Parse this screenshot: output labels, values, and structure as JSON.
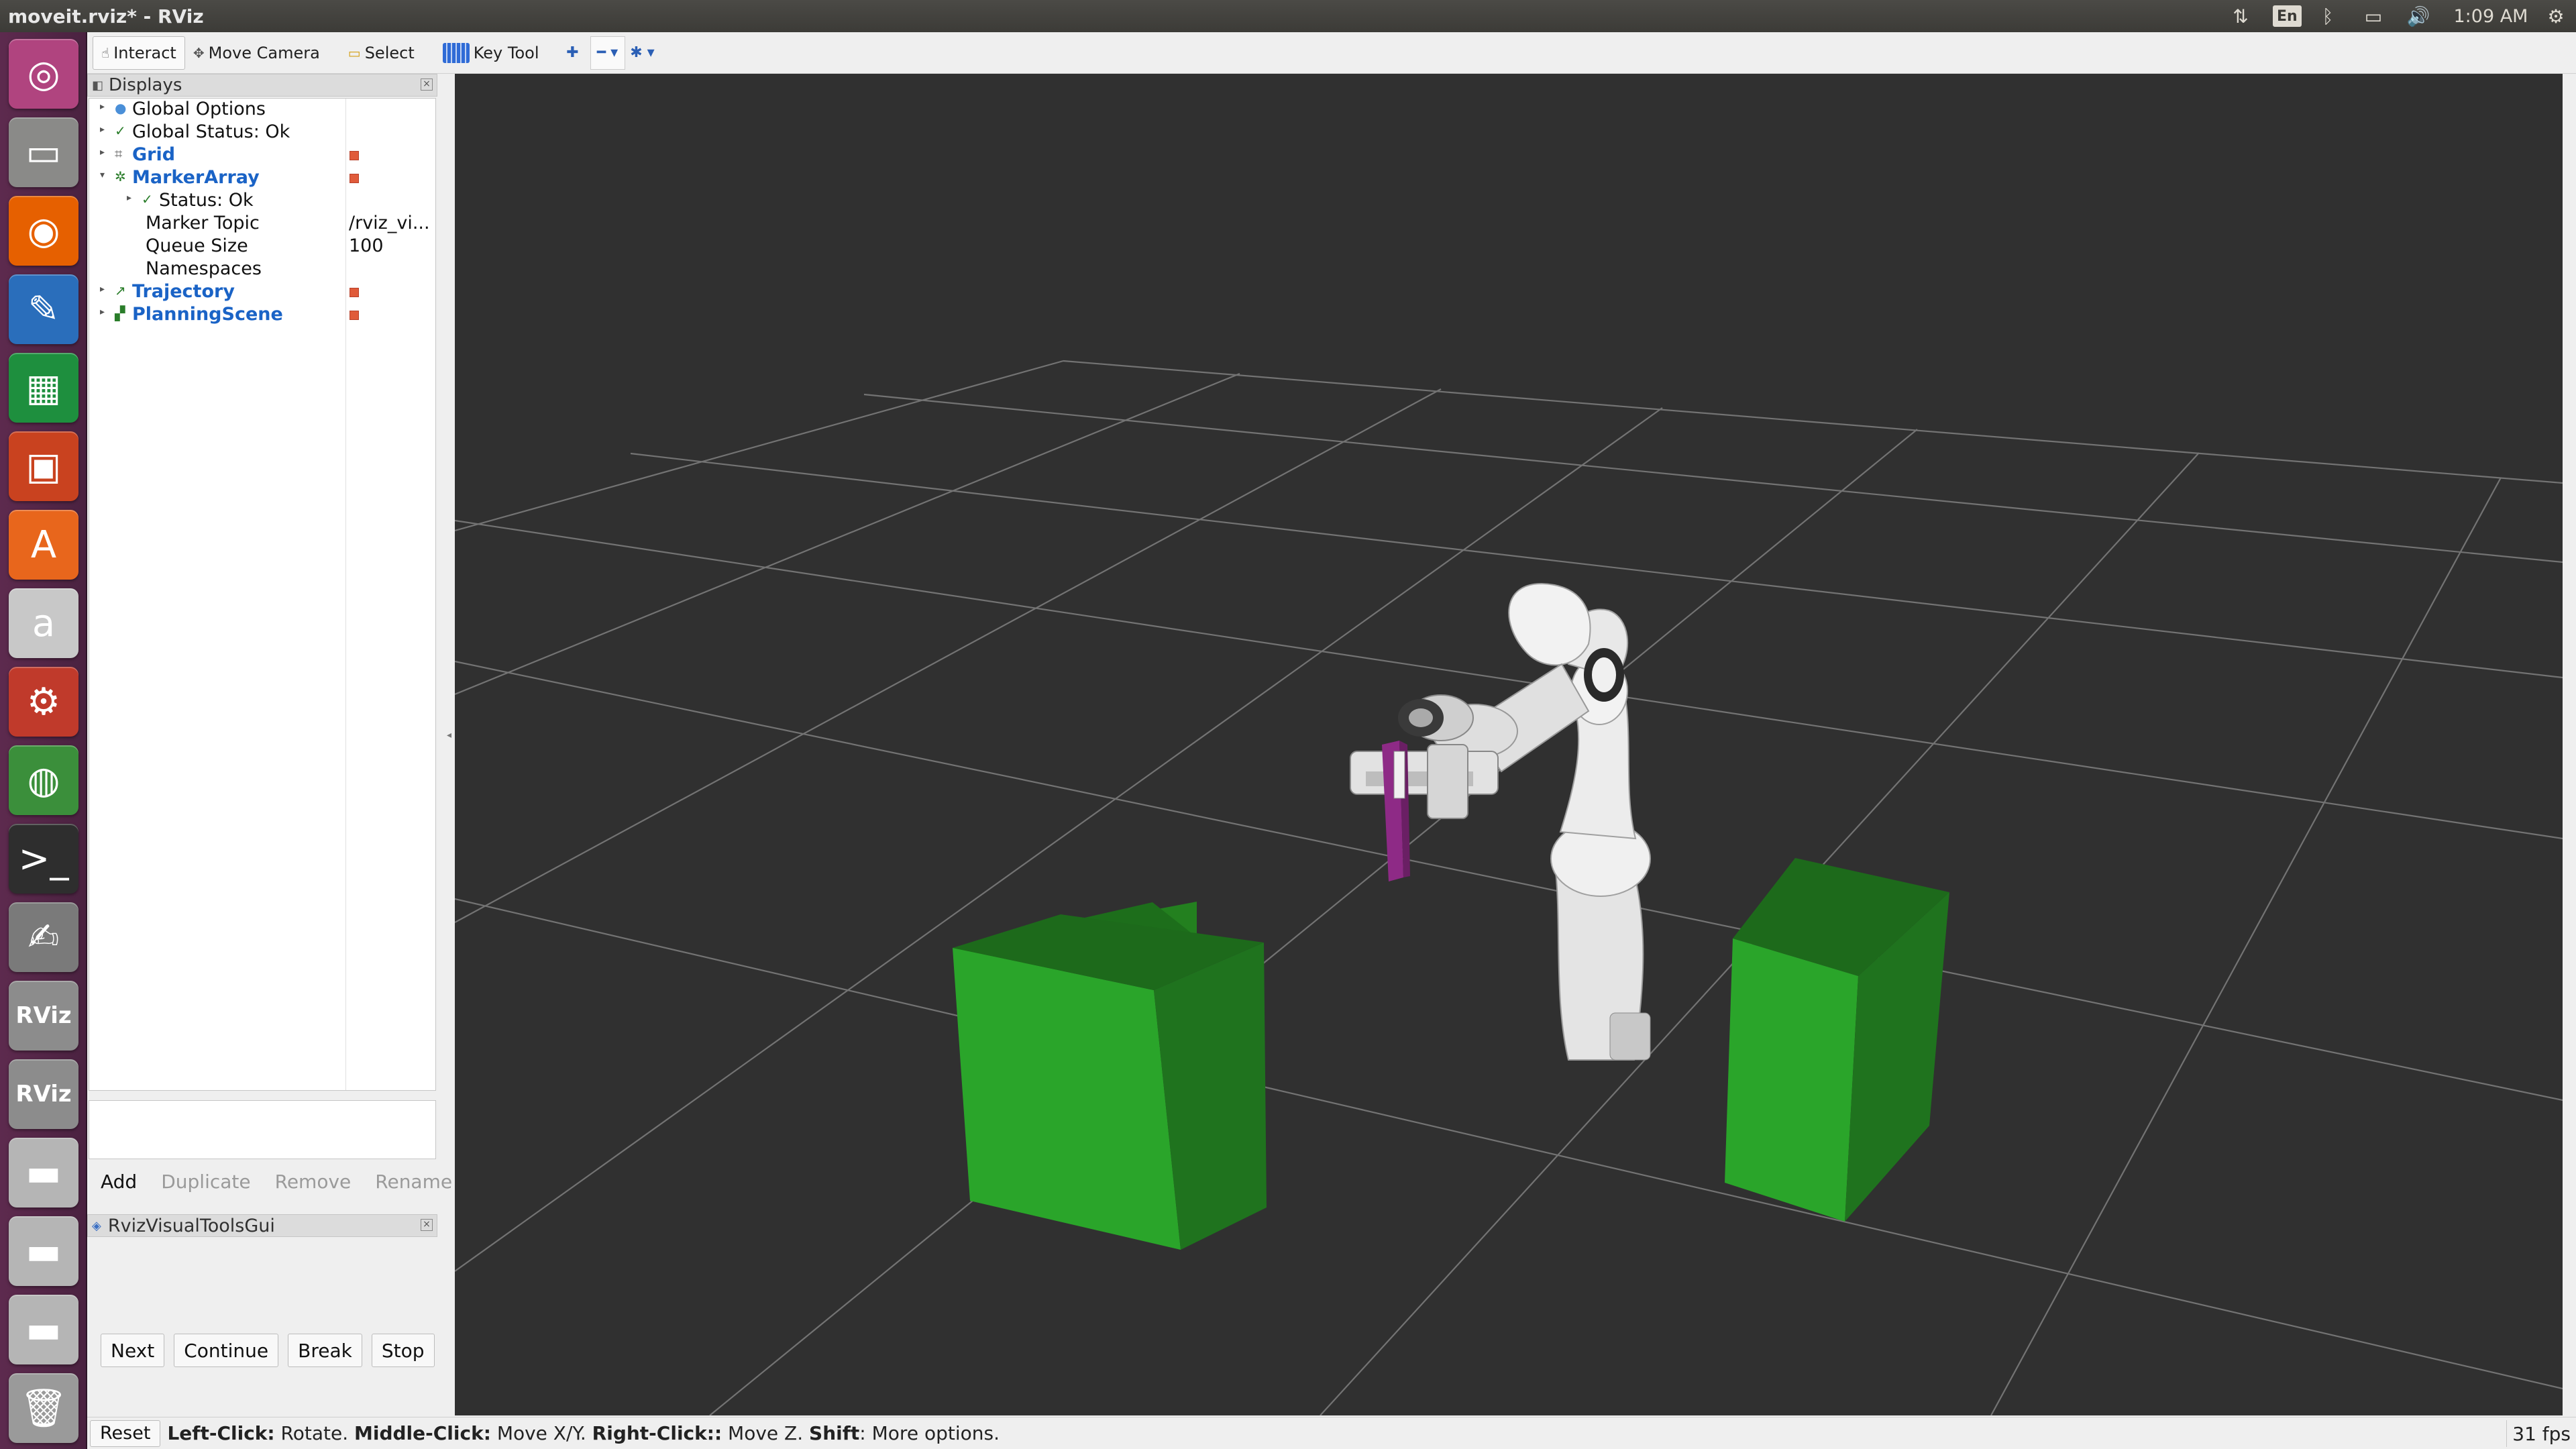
{
  "window": {
    "title": "moveit.rviz* - RViz"
  },
  "tray": {
    "network_icon": "network-arrows-icon",
    "language": "En",
    "bluetooth_icon": "bluetooth-icon",
    "battery_icon": "battery-icon",
    "volume_icon": "volume-icon",
    "clock": "1:09 AM",
    "settings_icon": "gear-icon"
  },
  "launcher": {
    "items": [
      {
        "name": "ubuntu-dash-icon",
        "color": "#b0447f",
        "glyph": "◎"
      },
      {
        "name": "files-icon",
        "color": "#8a8a88",
        "glyph": "▭"
      },
      {
        "name": "firefox-icon",
        "color": "#e66000",
        "glyph": "◉"
      },
      {
        "name": "writer-icon",
        "color": "#2a6ebb",
        "glyph": "✎"
      },
      {
        "name": "calc-icon",
        "color": "#1e8f3e",
        "glyph": "▦"
      },
      {
        "name": "impress-icon",
        "color": "#c9421f",
        "glyph": "▣"
      },
      {
        "name": "software-center-icon",
        "color": "#e8661c",
        "glyph": "A"
      },
      {
        "name": "amazon-icon",
        "color": "#c8c8c8",
        "glyph": "a"
      },
      {
        "name": "system-settings-icon",
        "color": "#c03a2b",
        "glyph": "⚙"
      },
      {
        "name": "chrome-icon",
        "color": "#3b8f3b",
        "glyph": "◍"
      },
      {
        "name": "terminal-icon",
        "color": "#2e2e2e",
        "glyph": ">_"
      },
      {
        "name": "text-editor-icon",
        "color": "#7a7a7a",
        "glyph": "✍"
      },
      {
        "name": "rviz-icon",
        "color": "#8c8c8c",
        "glyph": "RViz"
      },
      {
        "name": "rviz-icon-2",
        "color": "#8c8c8c",
        "glyph": "RViz"
      },
      {
        "name": "drive-icon",
        "color": "#b5b5b5",
        "glyph": "▬"
      },
      {
        "name": "drive-icon-2",
        "color": "#b5b5b5",
        "glyph": "▬"
      },
      {
        "name": "drive-icon-3",
        "color": "#b5b5b5",
        "glyph": "▬"
      },
      {
        "name": "trash-icon",
        "color": "#9a9a9a",
        "glyph": "🗑"
      }
    ]
  },
  "toolbar": {
    "interact": "Interact",
    "move_camera": "Move Camera",
    "select": "Select",
    "key_tool": "Key Tool"
  },
  "displays": {
    "title": "Displays",
    "rows": [
      {
        "label": "Global Options",
        "icon": "globe-icon",
        "value": ""
      },
      {
        "label": "Global Status: Ok",
        "icon": "check-icon",
        "value": ""
      },
      {
        "label": "Grid",
        "icon": "grid-icon",
        "value": ""
      },
      {
        "label": "MarkerArray",
        "icon": "marker-icon",
        "value": ""
      },
      {
        "label": "Status: Ok",
        "icon": "check-icon",
        "value": ""
      },
      {
        "label": "Marker Topic",
        "icon": "",
        "value": "/rviz_vi..."
      },
      {
        "label": "Queue Size",
        "icon": "",
        "value": "100"
      },
      {
        "label": "Namespaces",
        "icon": "",
        "value": ""
      },
      {
        "label": "Trajectory",
        "icon": "trajectory-icon",
        "value": ""
      },
      {
        "label": "PlanningScene",
        "icon": "planning-scene-icon",
        "value": ""
      }
    ],
    "buttons": {
      "add": "Add",
      "duplicate": "Duplicate",
      "remove": "Remove",
      "rename": "Rename"
    }
  },
  "rviz_visual_tools": {
    "title": "RvizVisualToolsGui",
    "buttons": {
      "next": "Next",
      "continue": "Continue",
      "break": "Break",
      "stop": "Stop"
    }
  },
  "status_bar": {
    "reset": "Reset",
    "left_click": "Left-Click:",
    "rotate": " Rotate. ",
    "middle_click": "Middle-Click:",
    "move_xy": " Move X/Y. ",
    "right_click": "Right-Click::",
    "move_z": " Move Z. ",
    "shift": "Shift",
    "more": ": More options.",
    "fps": "31 fps"
  },
  "scene": {
    "background": "#303030",
    "grid_color": "#8a8a8a",
    "box_color": "#28a428",
    "gripper_object_color": "#8e2a86",
    "robot_color": "#e8e8e8"
  }
}
